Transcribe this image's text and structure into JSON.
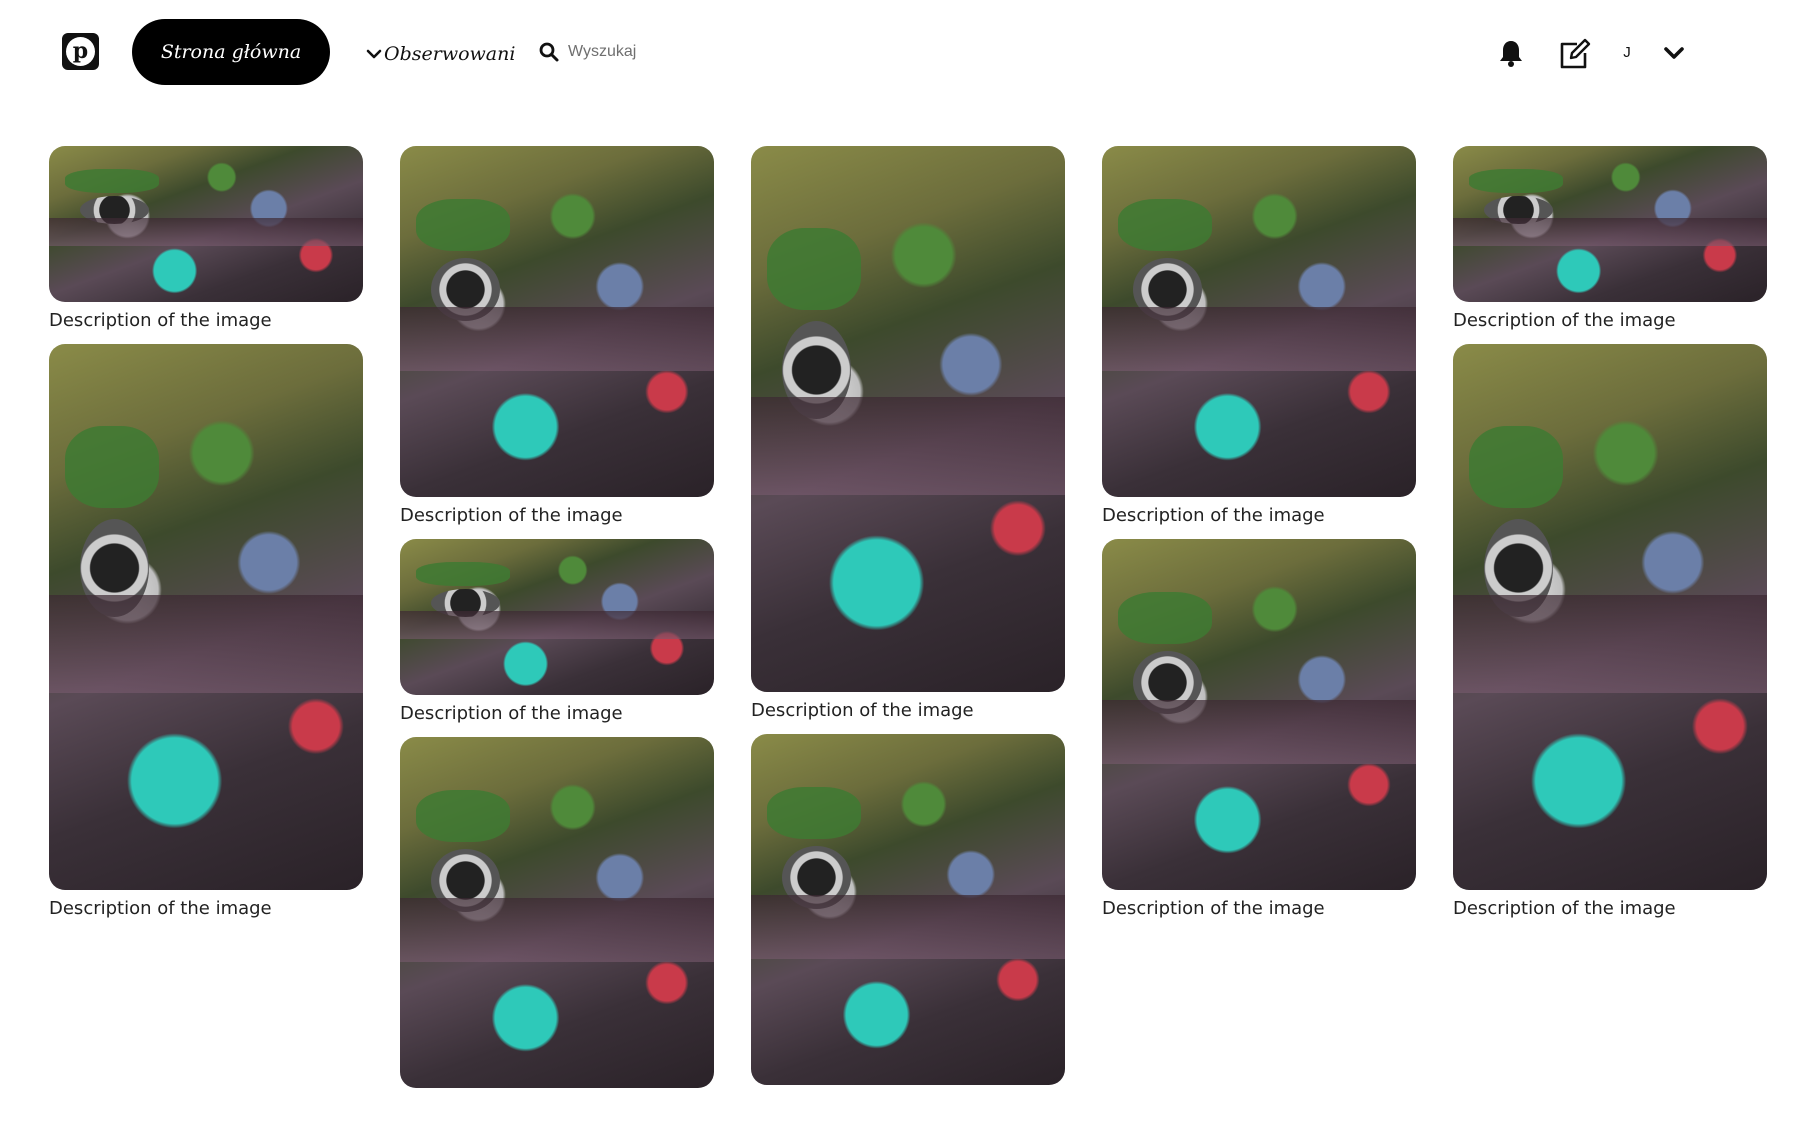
{
  "header": {
    "home_label": "Strona główna",
    "following_label": "Obserwowani",
    "search_placeholder": "Wyszukaj",
    "user_initial": "J"
  },
  "icons": {
    "logo": "pinterest-logo-icon",
    "following_chevron": "chevron-down-icon",
    "search": "search-icon",
    "notifications": "bell-icon",
    "edit": "edit-icon",
    "account_menu": "chevron-down-icon"
  },
  "colors": {
    "accent": "#000000",
    "background": "#ffffff"
  },
  "columns": [
    [
      {
        "size": "short",
        "caption": "Description of the image"
      },
      {
        "size": "tall",
        "caption": "Description of the image"
      }
    ],
    [
      {
        "size": "medium",
        "caption": "Description of the image"
      },
      {
        "size": "short",
        "caption": "Description of the image"
      },
      {
        "size": "medium",
        "caption": ""
      }
    ],
    [
      {
        "size": "tall",
        "caption": "Description of the image"
      },
      {
        "size": "medium",
        "caption": ""
      }
    ],
    [
      {
        "size": "medium",
        "caption": "Description of the image"
      },
      {
        "size": "medium",
        "caption": "Description of the image"
      }
    ],
    [
      {
        "size": "short",
        "caption": "Description of the image"
      },
      {
        "size": "tall",
        "caption": "Description of the image"
      }
    ]
  ]
}
